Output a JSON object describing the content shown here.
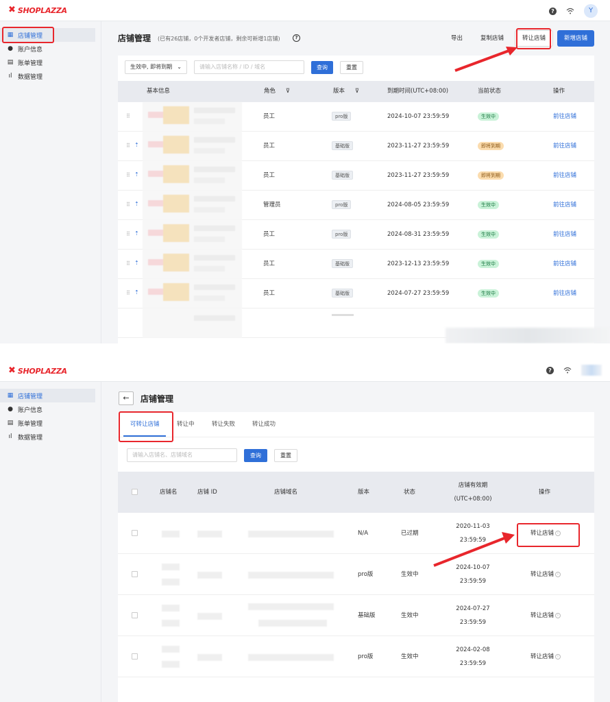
{
  "brand": {
    "logo": "SHOPLAZZA",
    "accent": "#2f6fd8",
    "brand_red": "#e8262c"
  },
  "sidebar": {
    "items": [
      {
        "label": "店铺管理",
        "icon": "store-icon"
      },
      {
        "label": "账户信息",
        "icon": "account-icon"
      },
      {
        "label": "账单管理",
        "icon": "bill-icon"
      },
      {
        "label": "数据管理",
        "icon": "chart-icon"
      }
    ]
  },
  "topbar": {
    "avatar_initial": "Y"
  },
  "screen1": {
    "title": "店铺管理",
    "subtitle": "(已有26店铺，0个开发者店铺，剩余可新增1店铺)",
    "buttons": {
      "export": "导出",
      "copy": "复制店铺",
      "transfer": "转让店铺",
      "new": "新增店铺"
    },
    "filter": {
      "select": "生效中, 即将到期",
      "placeholder": "请输入店铺名称 / ID / 域名",
      "search": "查询",
      "reset": "重置"
    },
    "columns": [
      "基本信息",
      "角色",
      "版本",
      "到期时间(UTC+08:00)",
      "当前状态",
      "操作"
    ],
    "rows": [
      {
        "role": "员工",
        "version": "pro版",
        "expire": "2024-10-07 23:59:59",
        "status": "生效中",
        "status_type": "green",
        "action": "前往店铺"
      },
      {
        "role": "员工",
        "version": "基础版",
        "expire": "2023-11-27 23:59:59",
        "status": "即将到期",
        "status_type": "orange",
        "action": "前往店铺"
      },
      {
        "role": "员工",
        "version": "基础版",
        "expire": "2023-11-27 23:59:59",
        "status": "即将到期",
        "status_type": "orange",
        "action": "前往店铺"
      },
      {
        "role": "管理员",
        "version": "pro版",
        "expire": "2024-08-05 23:59:59",
        "status": "生效中",
        "status_type": "green",
        "action": "前往店铺"
      },
      {
        "role": "员工",
        "version": "pro版",
        "expire": "2024-08-31 23:59:59",
        "status": "生效中",
        "status_type": "green",
        "action": "前往店铺"
      },
      {
        "role": "员工",
        "version": "基础版",
        "expire": "2023-12-13 23:59:59",
        "status": "生效中",
        "status_type": "green",
        "action": "前往店铺"
      },
      {
        "role": "员工",
        "version": "基础版",
        "expire": "2024-07-27 23:59:59",
        "status": "生效中",
        "status_type": "green",
        "action": "前往店铺"
      }
    ]
  },
  "screen2": {
    "title": "店铺管理",
    "tabs": [
      "可转让店铺",
      "转让中",
      "转让失败",
      "转让成功"
    ],
    "filter": {
      "placeholder": "请输入店铺名、店铺域名",
      "search": "查询",
      "reset": "重置"
    },
    "columns": {
      "name": "店铺名",
      "id": "店铺 ID",
      "domain": "店铺域名",
      "version": "版本",
      "status": "状态",
      "validity_1": "店铺有效期",
      "validity_2": "(UTC+08:00)",
      "action": "操作"
    },
    "rows": [
      {
        "version": "N/A",
        "status": "已过期",
        "date": "2020-11-03",
        "time": "23:59:59",
        "action": "转让店铺"
      },
      {
        "version": "pro版",
        "status": "生效中",
        "date": "2024-10-07",
        "time": "23:59:59",
        "action": "转让店铺"
      },
      {
        "version": "基础版",
        "status": "生效中",
        "date": "2024-07-27",
        "time": "23:59:59",
        "action": "转让店铺"
      },
      {
        "version": "pro版",
        "status": "生效中",
        "date": "2024-02-08",
        "time": "23:59:59",
        "action": "转让店铺"
      }
    ]
  }
}
